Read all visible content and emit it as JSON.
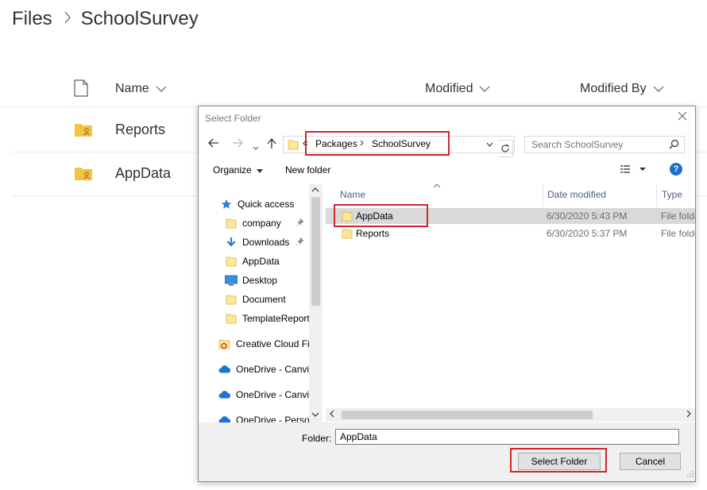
{
  "breadcrumb": {
    "root": "Files",
    "current": "SchoolSurvey"
  },
  "list": {
    "columns": [
      "Name",
      "Modified",
      "Modified By"
    ],
    "rows": [
      {
        "name": "Reports"
      },
      {
        "name": "AppData"
      }
    ]
  },
  "dialog": {
    "title": "Select Folder",
    "address": {
      "prefix": "«",
      "segments": [
        "Packages",
        "SchoolSurvey"
      ]
    },
    "search_placeholder": "Search SchoolSurvey",
    "toolbar": {
      "organize": "Organize",
      "new_folder": "New folder",
      "help": "?"
    },
    "nav_items": [
      {
        "label": "Quick access",
        "icon": "star-icon"
      },
      {
        "label": "company",
        "icon": "folder-icon",
        "pinned": true
      },
      {
        "label": "Downloads",
        "icon": "download-icon",
        "pinned": true
      },
      {
        "label": "AppData",
        "icon": "folder-icon"
      },
      {
        "label": "Desktop",
        "icon": "desktop-icon"
      },
      {
        "label": "Document",
        "icon": "folder-icon"
      },
      {
        "label": "TemplateReport",
        "icon": "folder-icon"
      },
      {
        "label": "Creative Cloud Fil",
        "icon": "creative-cloud-icon"
      },
      {
        "label": "OneDrive - Canviz",
        "icon": "cloud-icon"
      },
      {
        "label": "OneDrive - Canviz",
        "icon": "cloud-icon"
      },
      {
        "label": "OneDrive - Person",
        "icon": "cloud-icon"
      }
    ],
    "columns": [
      "Name",
      "Date modified",
      "Type"
    ],
    "files": [
      {
        "name": "AppData",
        "date": "6/30/2020 5:43 PM",
        "type": "File folder",
        "selected": true
      },
      {
        "name": "Reports",
        "date": "6/30/2020 5:37 PM",
        "type": "File folder",
        "selected": false
      }
    ],
    "folder_label": "Folder:",
    "folder_value": "AppData",
    "select_button": "Select Folder",
    "cancel_button": "Cancel"
  },
  "colors": {
    "highlight": "#d0262b",
    "folder": "#f5c242",
    "accent": "#1e6fc9"
  }
}
